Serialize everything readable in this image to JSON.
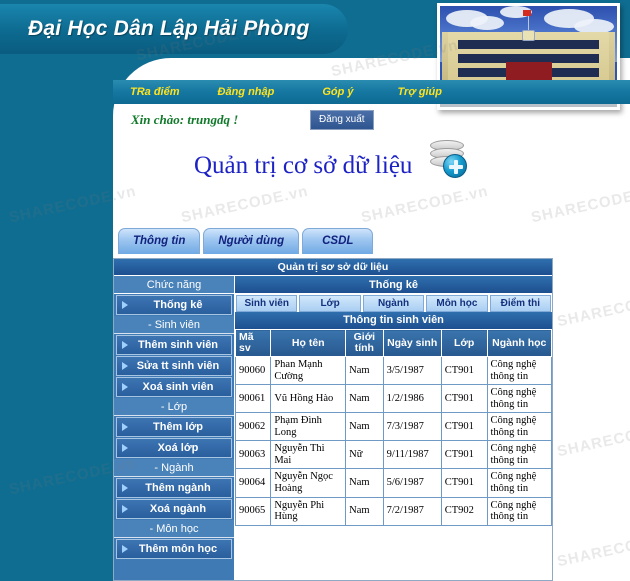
{
  "banner": {
    "university_name": "Đại Học Dân Lập Hải Phòng"
  },
  "nav": {
    "items": [
      {
        "label": "TRa điểm"
      },
      {
        "label": "Đăng nhập"
      },
      {
        "label": "Góp ý"
      },
      {
        "label": "Trợ giúp"
      }
    ]
  },
  "session": {
    "greeting": "Xin chào: trungdq !",
    "logout_label": "Đăng xuất"
  },
  "heading": {
    "title": "Quản trị cơ sở dữ liệu",
    "icon": "database-add-icon"
  },
  "tabs": [
    {
      "label": "Thông tin",
      "active": true
    },
    {
      "label": "Người dùng",
      "active": false
    },
    {
      "label": "CSDL",
      "active": false
    }
  ],
  "panel": {
    "title": "Quản trị sơ sở dữ liệu",
    "content_title": "Thống kê"
  },
  "sidebar": {
    "header": "Chức năng",
    "items": [
      {
        "label": "Thống kê",
        "type": "button"
      },
      {
        "label": "- Sinh viên",
        "type": "group"
      },
      {
        "label": "Thêm sinh viên",
        "type": "button"
      },
      {
        "label": "Sửa tt sinh viên",
        "type": "button"
      },
      {
        "label": "Xoá sinh viên",
        "type": "button"
      },
      {
        "label": "- Lớp",
        "type": "group"
      },
      {
        "label": "Thêm lớp",
        "type": "button"
      },
      {
        "label": "Xoá lớp",
        "type": "button"
      },
      {
        "label": "- Ngành",
        "type": "group"
      },
      {
        "label": "Thêm ngành",
        "type": "button"
      },
      {
        "label": "Xoá ngành",
        "type": "button"
      },
      {
        "label": "- Môn học",
        "type": "group"
      },
      {
        "label": "Thêm môn học",
        "type": "button"
      }
    ]
  },
  "subtabs": [
    {
      "label": "Sinh viên",
      "active": true
    },
    {
      "label": "Lớp",
      "active": false
    },
    {
      "label": "Ngành",
      "active": false
    },
    {
      "label": "Môn học",
      "active": false
    },
    {
      "label": "Điểm thi",
      "active": false
    }
  ],
  "table": {
    "caption": "Thông tin sinh viên",
    "columns": [
      "Mã sv",
      "Họ tên",
      "Giới tính",
      "Ngày sinh",
      "Lớp",
      "Ngành học"
    ],
    "rows": [
      {
        "ma_sv": "90060",
        "ho_ten": "Phan Mạnh Cường",
        "gioi_tinh": "Nam",
        "ngay_sinh": "3/5/1987",
        "lop": "CT901",
        "nganh_hoc": "Công nghệ thông tin"
      },
      {
        "ma_sv": "90061",
        "ho_ten": "Vũ Hồng Hào",
        "gioi_tinh": "Nam",
        "ngay_sinh": "1/2/1986",
        "lop": "CT901",
        "nganh_hoc": "Công nghệ thông tin"
      },
      {
        "ma_sv": "90062",
        "ho_ten": "Phạm Đình Long",
        "gioi_tinh": "Nam",
        "ngay_sinh": "7/3/1987",
        "lop": "CT901",
        "nganh_hoc": "Công nghệ thông tin"
      },
      {
        "ma_sv": "90063",
        "ho_ten": "Nguyễn Thi Mai",
        "gioi_tinh": "Nữ",
        "ngay_sinh": "9/11/1987",
        "lop": "CT901",
        "nganh_hoc": "Công nghệ thông tin"
      },
      {
        "ma_sv": "90064",
        "ho_ten": "Nguyễn Ngọc Hoàng",
        "gioi_tinh": "Nam",
        "ngay_sinh": "5/6/1987",
        "lop": "CT901",
        "nganh_hoc": "Công nghệ thông tin"
      },
      {
        "ma_sv": "90065",
        "ho_ten": "Nguyễn Phi Hùng",
        "gioi_tinh": "Nam",
        "ngay_sinh": "7/2/1987",
        "lop": "CT902",
        "nganh_hoc": "Công nghệ thông tin"
      }
    ]
  },
  "watermark": {
    "text": "SHARECODE.vn"
  },
  "colors": {
    "teal": "#0f6d91",
    "nav_text": "#ffe31f",
    "heading_blue": "#1d22c4",
    "greeting_green": "#117a2a",
    "panel_header": "#1d4f8f",
    "sidebar_bg": "#3f7ab4"
  }
}
